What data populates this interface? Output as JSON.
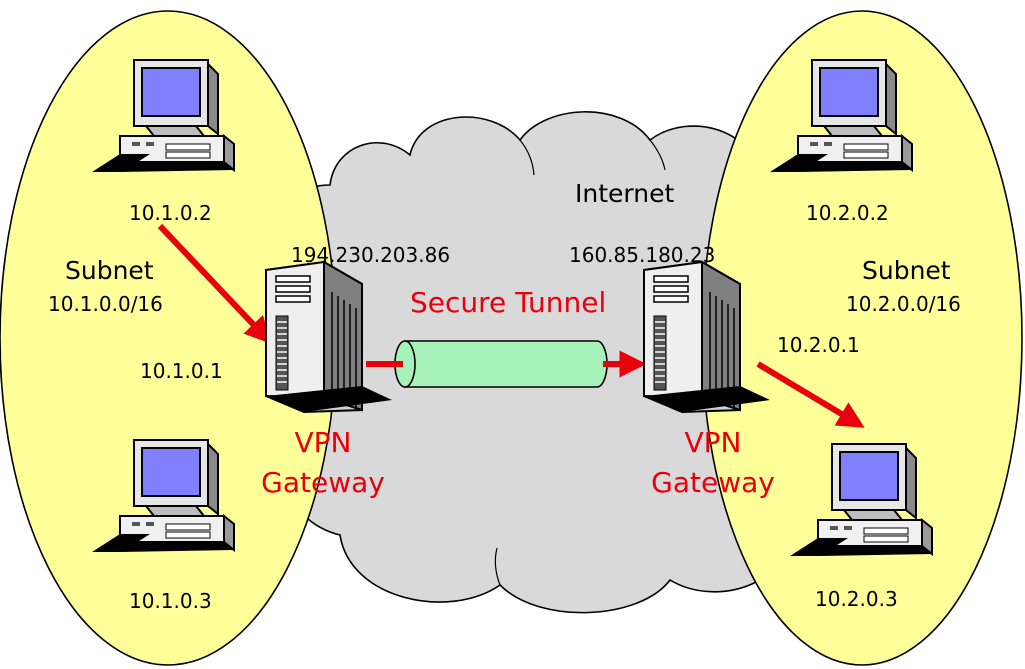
{
  "colors": {
    "subnet_fill": "#ffff99",
    "cloud_fill": "#d9d9d9",
    "tunnel_fill": "#a6f2b8",
    "arrow": "#e8000d",
    "screen": "#8080ff",
    "accent_text": "#e8000d"
  },
  "left": {
    "subnet_label": "Subnet",
    "subnet_cidr": "10.1.0.0/16",
    "top_host_ip": "10.1.0.2",
    "bottom_host_ip": "10.1.0.3",
    "gateway_inner_ip": "10.1.0.1",
    "gateway_public_ip": "194.230.203.86",
    "gateway_label_1": "VPN",
    "gateway_label_2": "Gateway",
    "host_icon": "desktop-computer-icon",
    "gateway_icon": "tower-server-icon"
  },
  "right": {
    "subnet_label": "Subnet",
    "subnet_cidr": "10.2.0.0/16",
    "top_host_ip": "10.2.0.2",
    "bottom_host_ip": "10.2.0.3",
    "gateway_inner_ip": "10.2.0.1",
    "gateway_public_ip": "160.85.180.23",
    "gateway_label_1": "VPN",
    "gateway_label_2": "Gateway",
    "host_icon": "desktop-computer-icon",
    "gateway_icon": "tower-server-icon"
  },
  "cloud": {
    "label": "Internet",
    "icon": "cloud-icon"
  },
  "tunnel": {
    "label": "Secure Tunnel",
    "icon": "tunnel-pipe-icon"
  }
}
